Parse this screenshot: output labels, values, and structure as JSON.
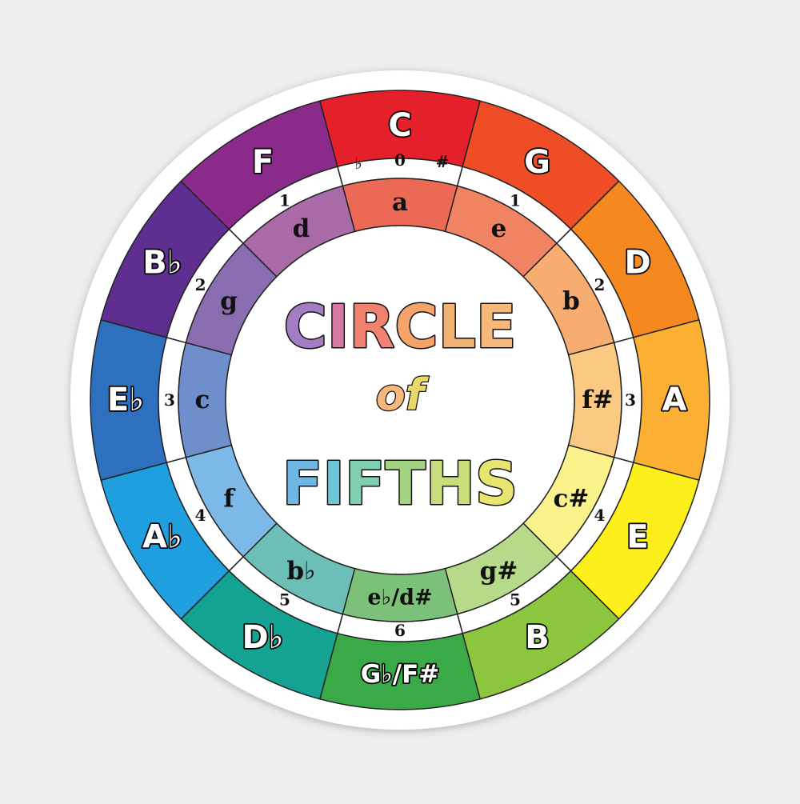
{
  "title": {
    "line1": "CIRCLE",
    "line2": "of",
    "line3": "FIFTHS"
  },
  "signature_labels": {
    "flat": "♭",
    "zero": "0",
    "sharp": "#"
  },
  "segments": [
    {
      "major": "C",
      "minor": "a",
      "count": "0",
      "color": "#e5202a",
      "minor_color": "#ec6a55"
    },
    {
      "major": "G",
      "minor": "e",
      "count": "1",
      "color": "#ee4d26",
      "minor_color": "#f08362"
    },
    {
      "major": "D",
      "minor": "b",
      "count": "2",
      "color": "#f5891f",
      "minor_color": "#f7ad70"
    },
    {
      "major": "A",
      "minor": "f#",
      "count": "3",
      "color": "#fbb034",
      "minor_color": "#fcc983"
    },
    {
      "major": "E",
      "minor": "c#",
      "count": "4",
      "color": "#fcef1c",
      "minor_color": "#faf38c"
    },
    {
      "major": "B",
      "minor": "g#",
      "count": "5",
      "color": "#8cc63f",
      "minor_color": "#b6d98a"
    },
    {
      "major": "G♭/F#",
      "minor": "e♭/d#",
      "count": "6",
      "color": "#3aaa49",
      "minor_color": "#7cc17a"
    },
    {
      "major": "D♭",
      "minor": "b♭",
      "count": "5",
      "color": "#14a392",
      "minor_color": "#6cbfb6"
    },
    {
      "major": "A♭",
      "minor": "f",
      "count": "4",
      "color": "#1f9ee0",
      "minor_color": "#7db9e6"
    },
    {
      "major": "E♭",
      "minor": "c",
      "count": "3",
      "color": "#2d70bd",
      "minor_color": "#6f8fcc"
    },
    {
      "major": "B♭",
      "minor": "g",
      "count": "2",
      "color": "#5e2e91",
      "minor_color": "#8a6cb0"
    },
    {
      "major": "F",
      "minor": "d",
      "count": "1",
      "color": "#8a2b8c",
      "minor_color": "#a96aa7"
    }
  ],
  "title_colors": {
    "line1": [
      "#a37cc4",
      "#d878a5",
      "#f0826f",
      "#f5a36a",
      "#f2b271",
      "#f5b77a"
    ],
    "line2": [
      "#f5b77a",
      "#e8d86b"
    ],
    "line3": [
      "#6fb7e0",
      "#6fc4d6",
      "#7fcfb0",
      "#a3d483",
      "#c9de7a",
      "#e7e56f"
    ]
  }
}
